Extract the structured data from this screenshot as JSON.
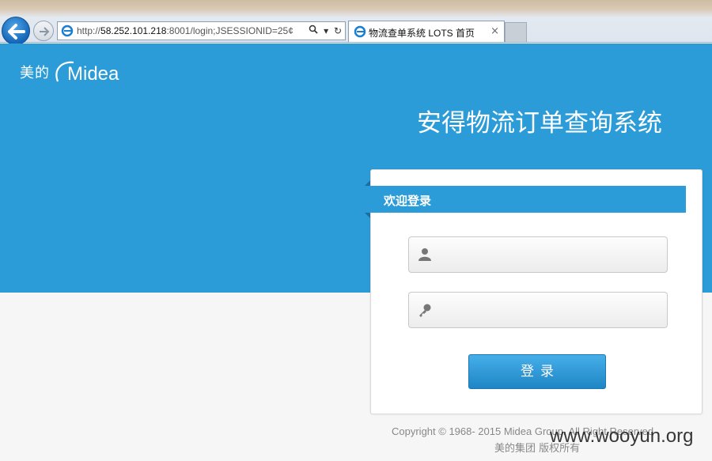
{
  "browser": {
    "address_prefix": "http://",
    "address_host": "58.252.101.218",
    "address_rest": ":8001/login;JSESSIONID=25¢",
    "search_icon": "search-icon",
    "dropdown_glyph": "▾",
    "refresh_glyph": "↻",
    "tab_title": "物流查单系统 LOTS 首页",
    "tab_close": "×"
  },
  "page": {
    "brand_cn": "美的",
    "brand_en": "Midea",
    "system_title": "安得物流订单查询系统",
    "welcome": "欢迎登录",
    "username_placeholder": "",
    "password_placeholder": "",
    "login_label": "登录",
    "copyright": "Copyright © 1968- 2015 Midea Group. All Right Reserved",
    "copyright_cn": "美的集团 版权所有",
    "watermark": "www.wooyun.org"
  },
  "colors": {
    "brand_blue": "#2b9cd8",
    "button_blue": "#1f86c6"
  }
}
